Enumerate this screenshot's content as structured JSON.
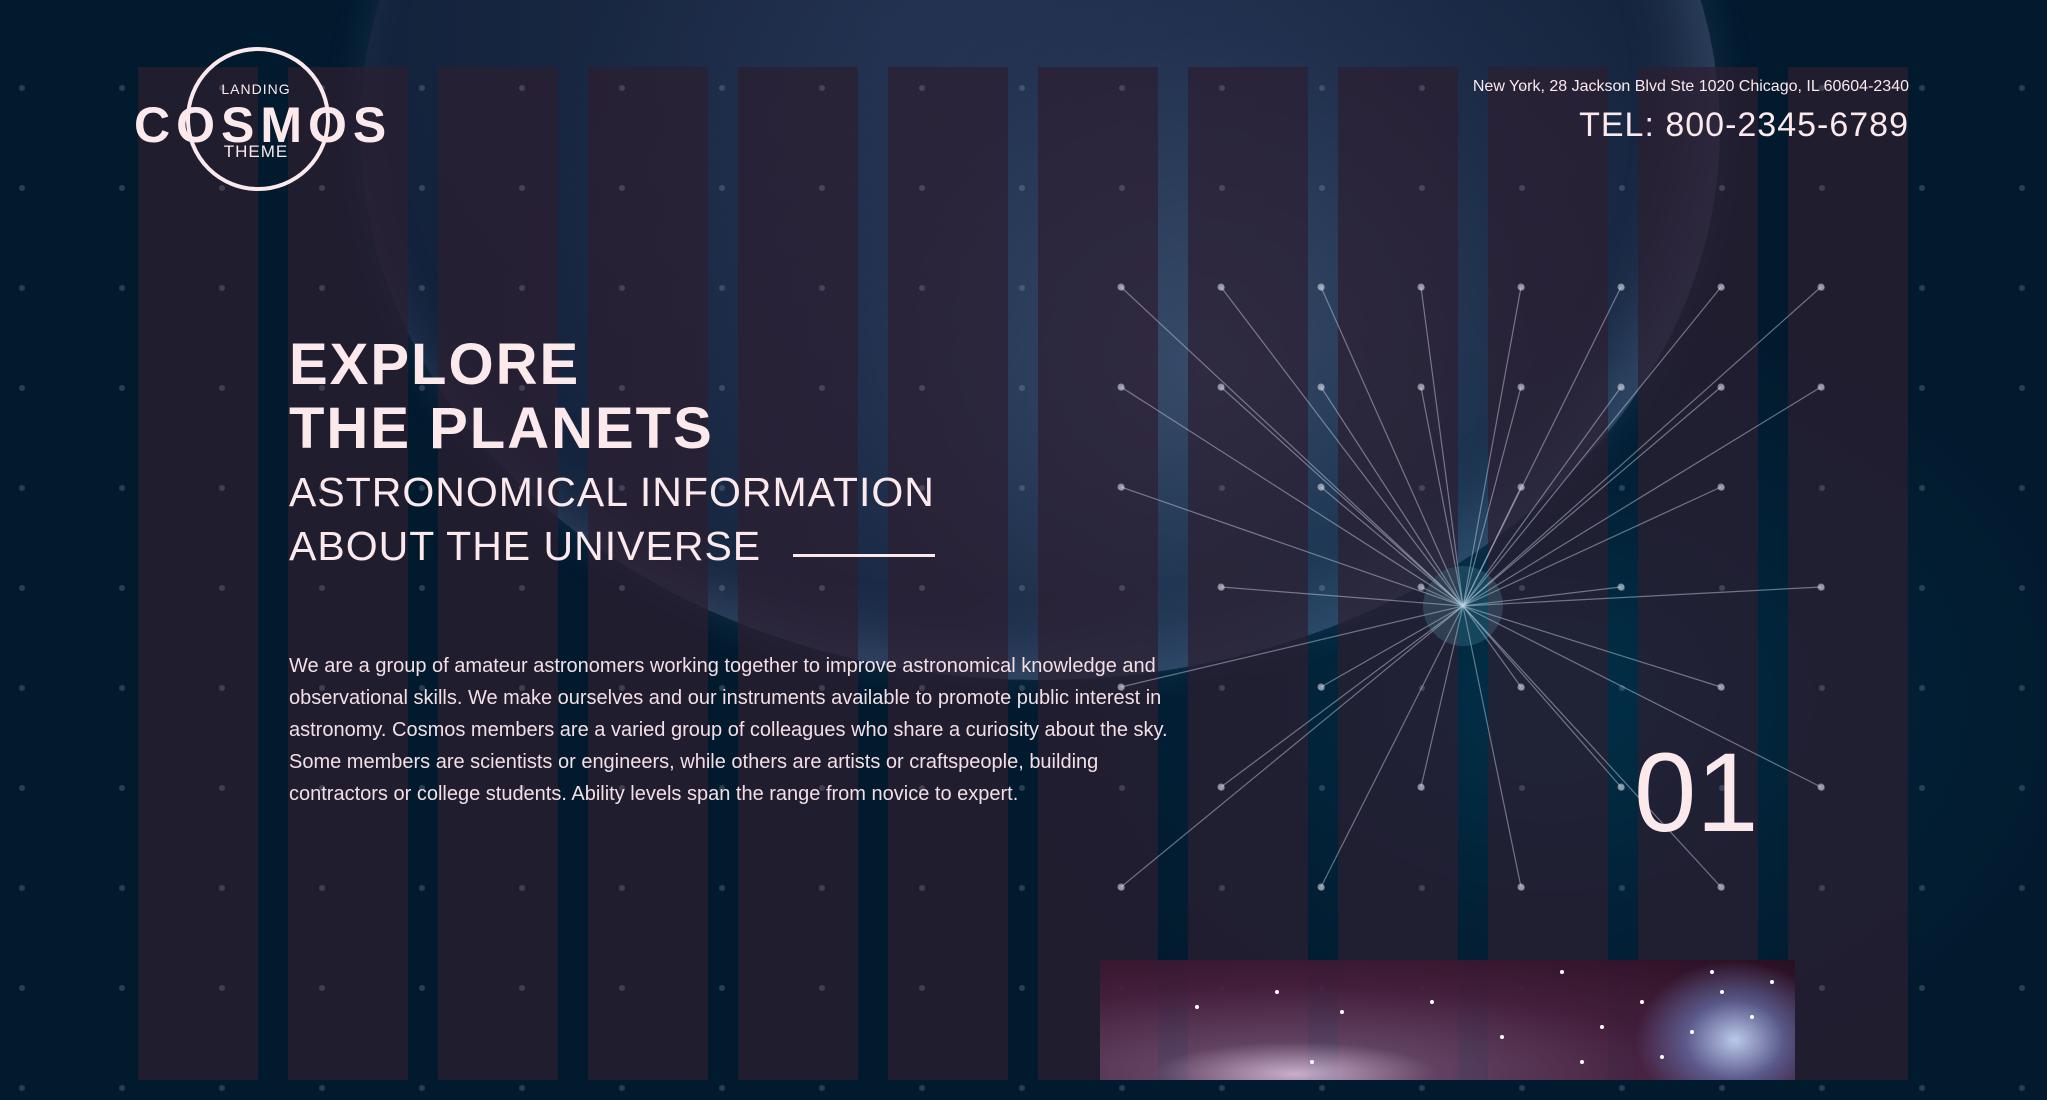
{
  "logo": {
    "top": "LANDING",
    "main": "COSMOS",
    "bottom": "THEME"
  },
  "contact": {
    "address": "New York, 28 Jackson Blvd Ste 1020 Chicago, IL 60604-2340",
    "tel": "TEL: 800-2345-6789"
  },
  "hero": {
    "title_line1": "EXPLORE",
    "title_line2": "THE PLANETS",
    "subtitle_line1": "ASTRONOMICAL INFORMATION",
    "subtitle_line2": "ABOUT THE UNIVERSE",
    "paragraph": "We are a group of amateur astronomers working together to improve astronomical knowledge and observational skills. We make ourselves and our instruments available to promote public interest in astronomy. Cosmos members are a varied group of colleagues who share a curiosity about the sky. Some members are scientists or engineers, while others are artists or craftspeople, building contractors or college students. Ability levels span the range from novice to expert."
  },
  "slider": {
    "current": "01"
  },
  "colors": {
    "background": "#021a2e",
    "text": "#fbe9ec",
    "stripe": "#2c1e30"
  }
}
